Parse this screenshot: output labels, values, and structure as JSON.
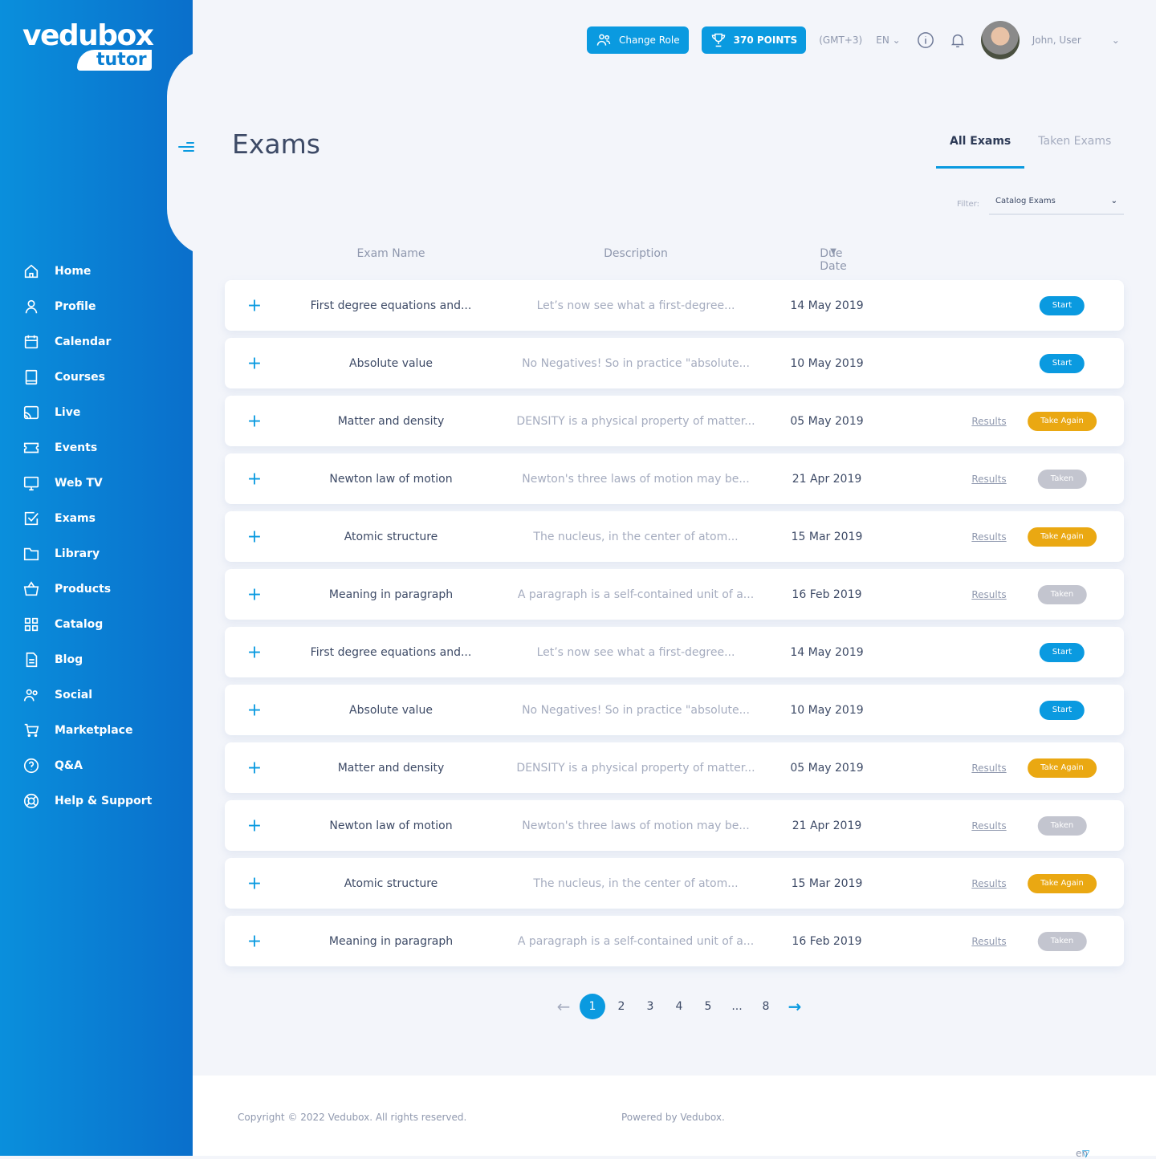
{
  "brand": {
    "name": "vedubox",
    "sub": "tutor"
  },
  "sidebar": {
    "items": [
      {
        "label": "Home",
        "icon": "home-icon"
      },
      {
        "label": "Profile",
        "icon": "user-icon"
      },
      {
        "label": "Calendar",
        "icon": "calendar-icon"
      },
      {
        "label": "Courses",
        "icon": "book-icon"
      },
      {
        "label": "Live",
        "icon": "cast-icon"
      },
      {
        "label": "Events",
        "icon": "ticket-icon"
      },
      {
        "label": "Web TV",
        "icon": "monitor-icon"
      },
      {
        "label": "Exams",
        "icon": "checkbox-icon"
      },
      {
        "label": "Library",
        "icon": "folder-icon"
      },
      {
        "label": "Products",
        "icon": "basket-icon"
      },
      {
        "label": "Catalog",
        "icon": "grid-icon"
      },
      {
        "label": "Blog",
        "icon": "document-icon"
      },
      {
        "label": "Social",
        "icon": "users-icon"
      },
      {
        "label": "Marketplace",
        "icon": "cart-icon"
      },
      {
        "label": "Q&A",
        "icon": "question-icon"
      },
      {
        "label": "Help & Support",
        "icon": "lifebuoy-icon"
      }
    ]
  },
  "topbar": {
    "change_role": "Change Role",
    "points": "370 POINTS",
    "timezone": "(GMT+3)",
    "language": "EN",
    "user": "John, User"
  },
  "page": {
    "title": "Exams",
    "tabs": [
      "All Exams",
      "Taken Exams"
    ],
    "filter_label": "Filter:",
    "filter_value": "Catalog Exams"
  },
  "table": {
    "headers": [
      "Exam Name",
      "Description",
      "Due Date"
    ],
    "results_label": "Results",
    "rows": [
      {
        "name": "First degree equations and...",
        "desc": "Let’s now see what a first-degree...",
        "date": "14 May 2019",
        "action": "Start",
        "results": false
      },
      {
        "name": "Absolute value",
        "desc": "No Negatives! So in practice \"absolute...",
        "date": "10 May 2019",
        "action": "Start",
        "results": false
      },
      {
        "name": "Matter and density",
        "desc": "DENSITY is a physical property of matter...",
        "date": "05 May 2019",
        "action": "Take Again",
        "results": true
      },
      {
        "name": "Newton law of motion",
        "desc": "Newton's three laws of motion may be...",
        "date": "21 Apr 2019",
        "action": "Taken",
        "results": true
      },
      {
        "name": "Atomic structure",
        "desc": "The nucleus, in the center of atom...",
        "date": "15 Mar 2019",
        "action": "Take Again",
        "results": true
      },
      {
        "name": "Meaning in paragraph",
        "desc": "A paragraph is a self-contained unit of a...",
        "date": "16 Feb 2019",
        "action": "Taken",
        "results": true
      },
      {
        "name": "First degree equations and...",
        "desc": "Let’s now see what a first-degree...",
        "date": "14 May 2019",
        "action": "Start",
        "results": false
      },
      {
        "name": "Absolute value",
        "desc": "No Negatives! So in practice \"absolute...",
        "date": "10 May 2019",
        "action": "Start",
        "results": false
      },
      {
        "name": "Matter and density",
        "desc": "DENSITY is a physical property of matter...",
        "date": "05 May 2019",
        "action": "Take Again",
        "results": true
      },
      {
        "name": "Newton law of motion",
        "desc": "Newton's three laws of motion may be...",
        "date": "21 Apr 2019",
        "action": "Taken",
        "results": true
      },
      {
        "name": "Atomic structure",
        "desc": "The nucleus, in the center of atom...",
        "date": "15 Mar 2019",
        "action": "Take Again",
        "results": true
      },
      {
        "name": "Meaning in paragraph",
        "desc": "A paragraph is a self-contained unit of a...",
        "date": "16 Feb 2019",
        "action": "Taken",
        "results": true
      }
    ]
  },
  "colors": {
    "Start": "#0a9ae0",
    "Take Again": "#eaa812",
    "Taken": "#c3c5cf"
  },
  "pagination": {
    "pages": [
      "1",
      "2",
      "3",
      "4",
      "5",
      "...",
      "8"
    ],
    "current": "1"
  },
  "footer": {
    "copyright": "Copyright © 2022 Vedubox. All rights reserved.",
    "powered": "Powered by Vedubox.",
    "lang": "en"
  }
}
